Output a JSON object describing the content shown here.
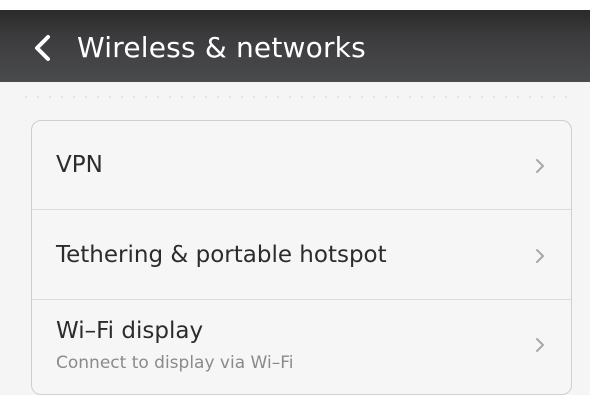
{
  "header": {
    "title": "Wireless & networks",
    "back_icon": "chevron-left-icon"
  },
  "settings": {
    "items": [
      {
        "label": "VPN",
        "sublabel": "",
        "icon": "chevron-right-icon"
      },
      {
        "label": "Tethering & portable hotspot",
        "sublabel": "",
        "icon": "chevron-right-icon"
      },
      {
        "label": "Wi–Fi display",
        "sublabel": "Connect to display via Wi–Fi",
        "icon": "chevron-right-icon"
      }
    ]
  },
  "colors": {
    "header_bg": "#3b3b3d",
    "header_text": "#ffffff",
    "page_bg": "#f5f5f5",
    "item_text": "#2c2c2c",
    "subtext": "#8a8a8a",
    "chevron": "#a8a8a8"
  }
}
